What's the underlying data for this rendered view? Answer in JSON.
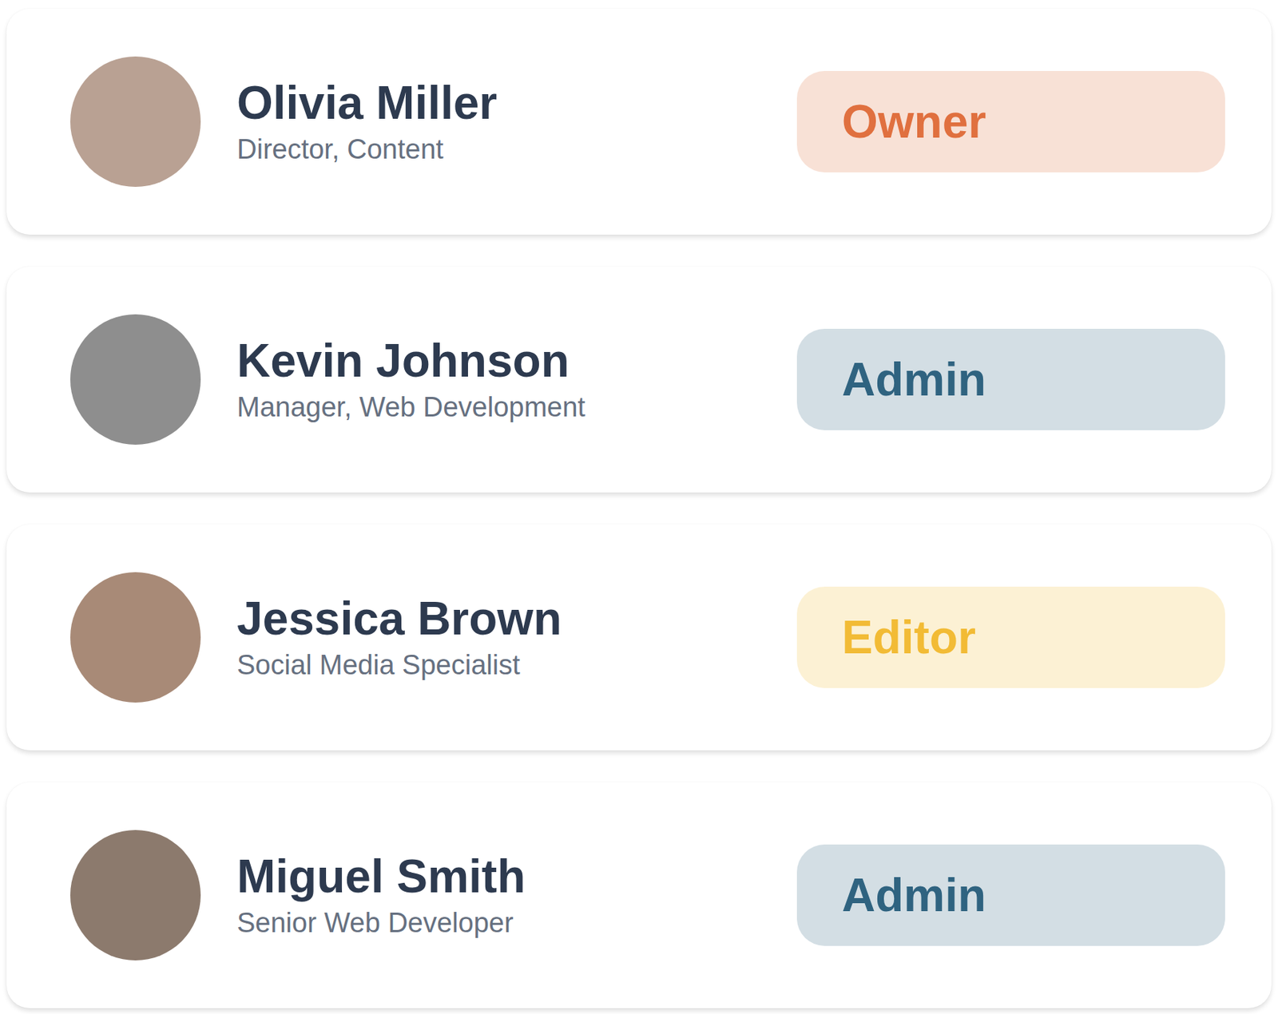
{
  "members": [
    {
      "name": "Olivia Miller",
      "title": "Director, Content",
      "role": "Owner",
      "color": "#e0703f"
    },
    {
      "name": "Kevin Johnson",
      "title": "Manager, Web Development",
      "role": "Admin",
      "color": "#2f6380"
    },
    {
      "name": "Jessica Brown",
      "title": "Social Media Specialist",
      "role": "Editor",
      "color": "#f2bb35"
    },
    {
      "name": "Miguel Smith",
      "title": "Senior Web Developer",
      "role": "Admin",
      "color": "#2f6380"
    }
  ]
}
